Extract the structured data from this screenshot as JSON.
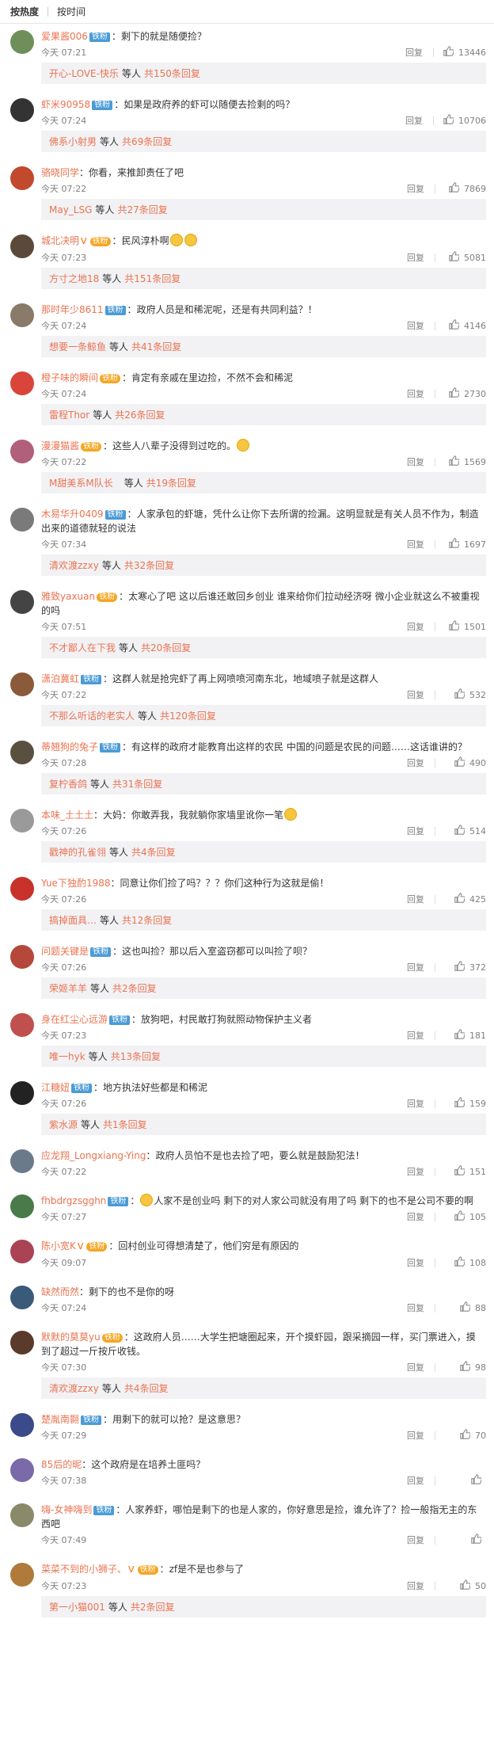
{
  "tabs": {
    "hot": "按热度",
    "time": "按时间"
  },
  "reply_label": "回复",
  "comments": [
    {
      "user": "爱果酱006",
      "badge": "铁粉",
      "sep": "：",
      "text": "剩下的就是随便捡？",
      "time": "今天 07:21",
      "likes": "13446",
      "sub": {
        "name": "开心-LOVE-快乐",
        "deng": "等人",
        "count": "共150条回复"
      },
      "avatar": "#6f8f5a"
    },
    {
      "user": "虾米90958",
      "badge": "铁粉",
      "sep": "：",
      "text": "如果是政府养的虾可以随便去捡剩的吗？",
      "time": "今天 07:24",
      "likes": "10706",
      "sub": {
        "name": "佛系小射男",
        "deng": "等人",
        "count": "共69条回复"
      },
      "avatar": "#333333"
    },
    {
      "user": "骆晓同学",
      "sep": "：",
      "text": "你看，来推卸责任了吧",
      "time": "今天 07:22",
      "likes": "7869",
      "sub": {
        "name": "May_LSG",
        "deng": "等人",
        "count": "共27条回复"
      },
      "avatar": "#c0492e"
    },
    {
      "user": "城北决明",
      "vip": "V",
      "crown": "铁粉",
      "sep": "：",
      "text": "民风淳朴啊",
      "emoji2": true,
      "time": "今天 07:23",
      "likes": "5081",
      "sub": {
        "name": "方寸之地18",
        "deng": "等人",
        "count": "共151条回复"
      },
      "avatar": "#5b4a3a"
    },
    {
      "user": "那时年少8611",
      "badge": "铁粉",
      "sep": "：",
      "text": "政府人员是和稀泥呢，还是有共同利益？！",
      "time": "今天 07:24",
      "likes": "4146",
      "sub": {
        "name": "想要一条鲸鱼",
        "deng": "等人",
        "count": "共41条回复"
      },
      "avatar": "#8a7a6a"
    },
    {
      "user": "橙子味的瞬间",
      "crown": "铁粉",
      "sep": "：",
      "text": "肯定有亲戚在里边捡，不然不会和稀泥",
      "time": "今天 07:24",
      "likes": "2730",
      "sub": {
        "name": "雷程Thor",
        "deng": "等人",
        "count": "共26条回复"
      },
      "avatar": "#d9453a"
    },
    {
      "user": "漫漫猫酱",
      "crown": "铁粉",
      "sep": "：",
      "text": "这些人八辈子没得到过吃的。",
      "emoji1": true,
      "time": "今天 07:22",
      "likes": "1569",
      "sub": {
        "name": "M甜美系M队长",
        "deng": "等人",
        "count": "共19条回复",
        "vip": true
      },
      "avatar": "#b0607a"
    },
    {
      "user": "木易华升0409",
      "badge": "铁粉",
      "sep": "：",
      "text": "人家承包的虾塘，凭什么让你下去所谓的捡漏。这明显就是有关人员不作为，制造出来的道德就轻的说法",
      "time": "今天 07:34",
      "likes": "1697",
      "sub": {
        "name": "清欢渡zzxy",
        "deng": "等人",
        "count": "共32条回复"
      },
      "avatar": "#7a7a7a"
    },
    {
      "user": "雅致yaxuan",
      "crown": "铁粉",
      "sep": "：",
      "text": "太寒心了吧 这以后谁还敢回乡创业 谁来给你们拉动经济呀 微小企业就这么不被重视的吗",
      "time": "今天 07:51",
      "likes": "1501",
      "sub": {
        "name": "不才鄙人在下我",
        "deng": "等人",
        "count": "共20条回复"
      },
      "avatar": "#444444"
    },
    {
      "user": "潇泊冀虹",
      "badge": "铁粉",
      "sep": "：",
      "text": "这群人就是抢完虾了再上网喷喷河南东北，地域喷子就是这群人",
      "time": "今天 07:22",
      "likes": "532",
      "sub": {
        "name": "不那么听话的老实人",
        "deng": "等人",
        "count": "共120条回复"
      },
      "avatar": "#8a5a3a"
    },
    {
      "user": "蒂翘狗的兔子",
      "badge": "铁粉",
      "sep": "：",
      "text": "有这样的政府才能教育出这样的农民  中国的问题是农民的问题……这话谁讲的？",
      "time": "今天 07:28",
      "likes": "490",
      "sub": {
        "name": "复柠香鸽",
        "deng": "等人",
        "count": "共31条回复"
      },
      "avatar": "#5a5040"
    },
    {
      "user": "本味_土土土",
      "sep": "：",
      "text": "大妈：你敢弄我，我就躺你家墙里讹你一笔",
      "emoji1": true,
      "time": "今天 07:26",
      "likes": "514",
      "sub": {
        "name": "戳神的孔雀翎",
        "deng": "等人",
        "count": "共4条回复"
      },
      "avatar": "#9a9a9a"
    },
    {
      "user": "Yue下独酌1988",
      "sep": "：",
      "text": "同意让你们捡了吗？？？你们这种行为这就是偷！",
      "time": "今天 07:26",
      "likes": "425",
      "sub": {
        "name": "搞掉面具…",
        "deng": "等人",
        "count": "共12条回复"
      },
      "avatar": "#c8322a"
    },
    {
      "user": "问题关键是",
      "badge": "铁粉",
      "sep": "：",
      "text": "这也叫捡？那以后入室盗窃都可以叫捡了呗？",
      "time": "今天 07:26",
      "likes": "372",
      "sub": {
        "name": "荣姬羊羊",
        "deng": "等人",
        "count": "共2条回复"
      },
      "avatar": "#b5483a"
    },
    {
      "user": "身在红尘心远游",
      "badge": "铁粉",
      "sep": "：",
      "text": "放狗吧，村民敢打狗就照动物保护主义者",
      "time": "今天 07:23",
      "likes": "181",
      "sub": {
        "name": "唯一hyk",
        "deng": "等人",
        "count": "共13条回复"
      },
      "avatar": "#c0504d"
    },
    {
      "user": "江糖妞",
      "badge": "铁粉",
      "sep": "：",
      "text": "地方执法好些都是和稀泥",
      "time": "今天 07:26",
      "likes": "159",
      "sub": {
        "name": "紫水源",
        "deng": "等人",
        "count": "共1条回复"
      },
      "avatar": "#222222"
    },
    {
      "user": "应龙翔_Longxiang-Ying",
      "sep": "：",
      "text": "政府人员怕不是也去捡了吧，要么就是鼓励犯法！",
      "time": "今天 07:22",
      "likes": "151",
      "avatar": "#6a7a8a"
    },
    {
      "user": "fhbdrgzsgghn",
      "badge": "铁粉",
      "sep": "：",
      "text": "人家不是创业吗 剩下的对人家公司就没有用了吗  剩下的也不是公司不要的啊",
      "emoji1": true,
      "time": "今天 07:27",
      "likes": "105",
      "avatar": "#4a7a4a"
    },
    {
      "user": "陈小宽K",
      "vip": "V",
      "crown": "铁粉",
      "sep": "：",
      "text": "回村创业可得想清楚了，他们穷是有原因的",
      "time": "今天 09:07",
      "likes": "108",
      "avatar": "#aa4455"
    },
    {
      "user": "缺然而然",
      "sep": "：",
      "text": "剩下的也不是你的呀",
      "time": "今天 07:24",
      "likes": "88",
      "avatar": "#3a5a7a"
    },
    {
      "user": "默默的莫莫yu",
      "crown": "铁粉",
      "sep": "：",
      "text": "这政府人员……大学生把塘圈起来，开个摸虾园，跟采摘园一样，买门票进入，摸到了超过一斤按斤收钱。",
      "time": "今天 07:30",
      "likes": "98",
      "sub": {
        "name": "清欢渡zzxy",
        "deng": "等人",
        "count": "共4条回复"
      },
      "avatar": "#5a3a2a"
    },
    {
      "user": "楚胤南翾",
      "badge": "铁粉",
      "sep": "：",
      "text": "用剩下的就可以抢？是这意思？",
      "time": "今天 07:29",
      "likes": "70",
      "avatar": "#3a4a8a"
    },
    {
      "user": "85后的昵",
      "sep": "：",
      "text": "这个政府是在培养土匪吗？",
      "time": "今天 07:38",
      "likes": "",
      "avatar": "#7a6aaa"
    },
    {
      "user": "嗨-女神嗨到",
      "badge": "铁粉",
      "sep": "：",
      "text": "人家养虾，哪怕是剩下的也是人家的，你好意思是捡，谁允许了？捡一般指无主的东西吧",
      "time": "今天 07:49",
      "likes": "",
      "avatar": "#8a8a6a"
    },
    {
      "user": "菜菜不到的小狮子、",
      "vip": "V",
      "crown": "铁粉",
      "sep": "：",
      "text": "zf是不是也参与了",
      "time": "今天 07:23",
      "likes": "50",
      "sub": {
        "name": "第一小猫001",
        "deng": "等人",
        "count": "共2条回复"
      },
      "avatar": "#b07a3a"
    }
  ]
}
